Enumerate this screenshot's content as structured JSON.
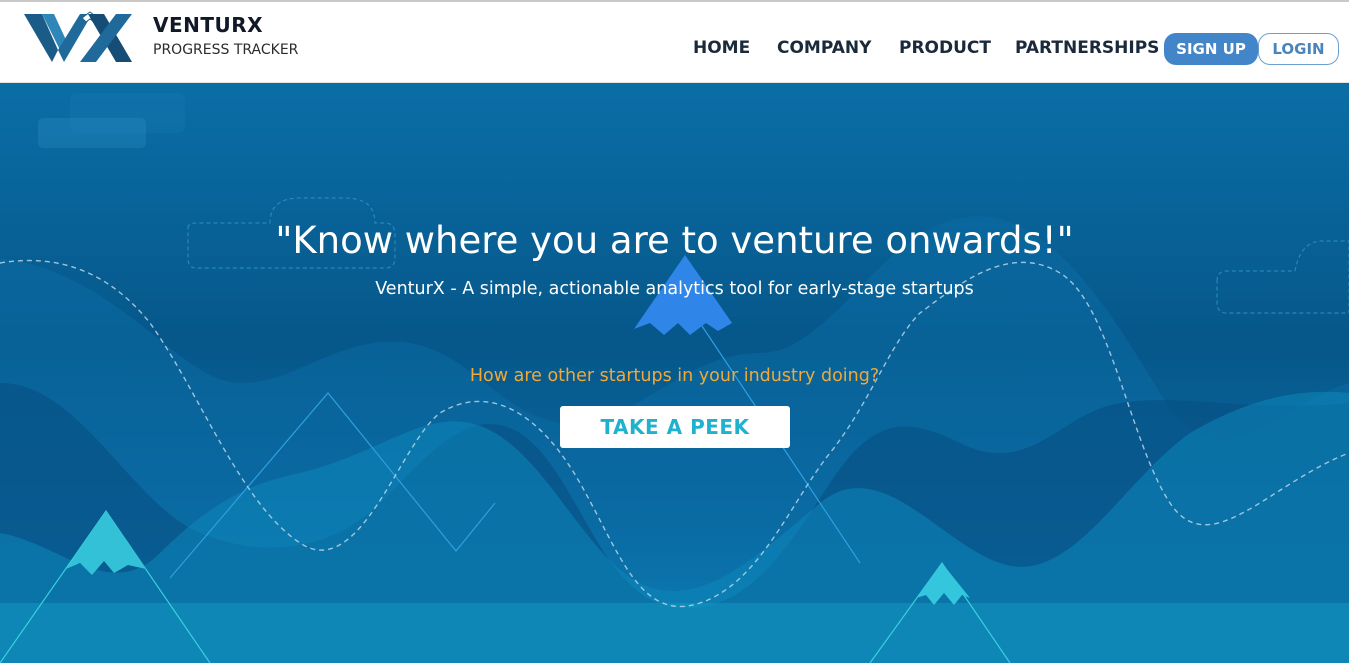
{
  "brand": {
    "logo_text": "VX",
    "name": "VENTURX",
    "tagline": "PROGRESS TRACKER"
  },
  "nav": {
    "items": [
      "HOME",
      "COMPANY",
      "PRODUCT",
      "PARTNERSHIPS"
    ],
    "signup_label": "SIGN UP",
    "login_label": "LOGIN"
  },
  "hero": {
    "headline": "\"Know where you are to venture onwards!\"",
    "subheadline": "VenturX - A simple, actionable analytics tool for early-stage startups",
    "question": "How are other startups in your industry doing?",
    "cta_label": "TAKE A PEEK"
  },
  "colors": {
    "accent_blue": "#4285c9",
    "hero_deep": "#06578a",
    "hero_light": "#0f94c4",
    "question_orange": "#f0a93a",
    "cta_text": "#1fb2cf"
  }
}
